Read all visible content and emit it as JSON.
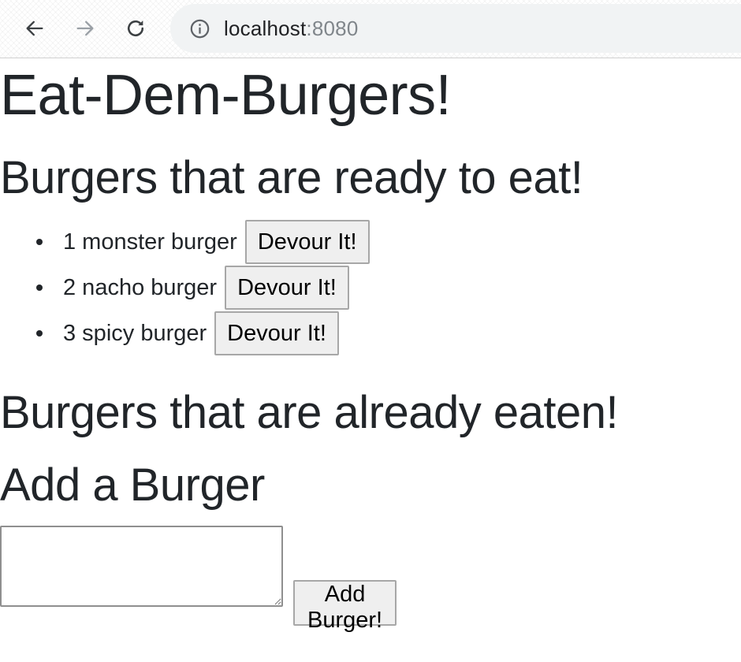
{
  "browser": {
    "url_host": "localhost",
    "url_port": ":8080",
    "icons": {
      "back": "arrow-left-icon",
      "forward": "arrow-right-icon",
      "reload": "reload-icon",
      "info": "info-icon"
    }
  },
  "page": {
    "title": "Eat-Dem-Burgers!",
    "ready_heading": "Burgers that are ready to eat!",
    "ready_burgers": [
      {
        "label": "1 monster burger",
        "button": "Devour It!"
      },
      {
        "label": "2 nacho burger",
        "button": "Devour It!"
      },
      {
        "label": "3 spicy burger",
        "button": "Devour It!"
      }
    ],
    "eaten_heading": "Burgers that are already eaten!",
    "add_heading": "Add a Burger",
    "add_input_value": "",
    "add_button": "Add Burger!"
  },
  "colors": {
    "text": "#212529",
    "button_bg": "#efefef",
    "omnibox_bg": "#f1f3f4"
  }
}
